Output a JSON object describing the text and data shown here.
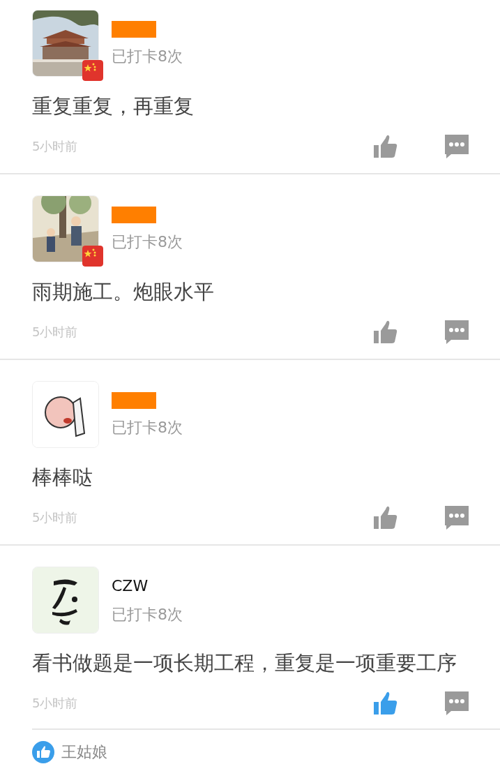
{
  "posts": [
    {
      "avatar": {
        "kind": "building",
        "flag": true
      },
      "name_hidden": true,
      "checkin": "已打卡8次",
      "text": "重复重复，再重复",
      "time": "5小时前",
      "liked": false
    },
    {
      "avatar": {
        "kind": "park",
        "flag": true
      },
      "name_hidden": true,
      "checkin": "已打卡8次",
      "text": "雨期施工。炮眼水平",
      "time": "5小时前",
      "liked": false
    },
    {
      "avatar": {
        "kind": "sticker",
        "flag": false
      },
      "name_hidden": true,
      "checkin": "已打卡8次",
      "text": "棒棒哒",
      "time": "5小时前",
      "liked": false
    },
    {
      "avatar": {
        "kind": "brush",
        "flag": false
      },
      "name_hidden": false,
      "name": "CZW",
      "checkin": "已打卡8次",
      "text": "看书做题是一项长期工程，重复是一项重要工序",
      "time": "5小时前",
      "liked": true,
      "likes": [
        {
          "name": "王姑娘"
        }
      ]
    }
  ]
}
